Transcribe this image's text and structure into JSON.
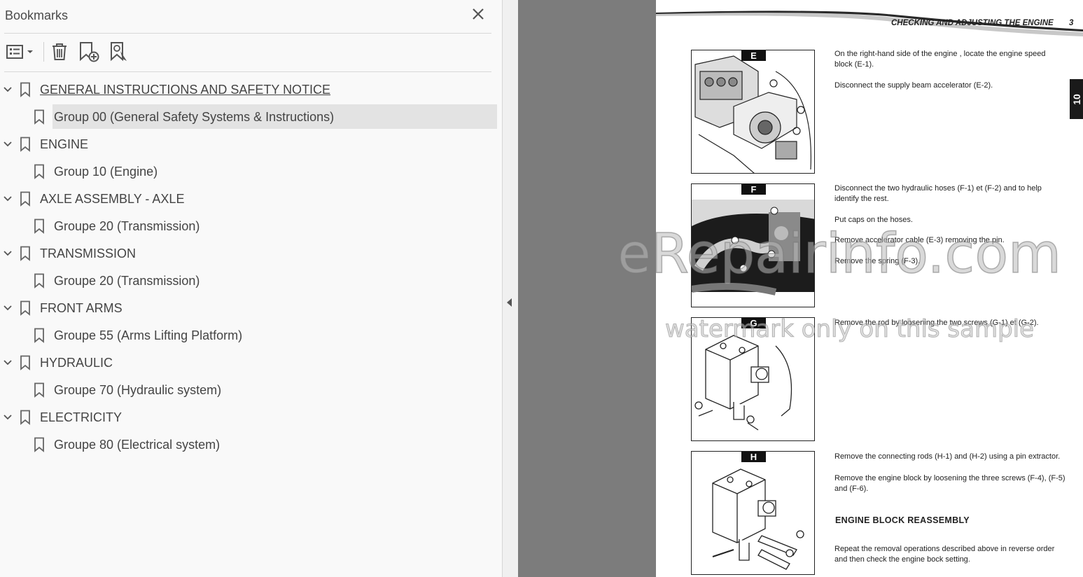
{
  "bookmarks_panel": {
    "title": "Bookmarks",
    "toolbar": {
      "options_icon": "list-options-icon",
      "delete_icon": "trash-icon",
      "add_icon": "add-bookmark-icon",
      "find_icon": "find-bookmark-icon"
    },
    "items": [
      {
        "label": "GENERAL INSTRUCTIONS AND SAFETY NOTICE",
        "level": 0,
        "expanded": true
      },
      {
        "label": "Group 00 (General Safety Systems & Instructions)",
        "level": 1,
        "selected": true
      },
      {
        "label": "ENGINE",
        "level": 0,
        "expanded": true
      },
      {
        "label": "Group 10 (Engine)",
        "level": 1
      },
      {
        "label": "AXLE ASSEMBLY - AXLE",
        "level": 0,
        "expanded": true
      },
      {
        "label": "Groupe 20 (Transmission)",
        "level": 1
      },
      {
        "label": "TRANSMISSION",
        "level": 0,
        "expanded": true
      },
      {
        "label": "Groupe 20 (Transmission)",
        "level": 1
      },
      {
        "label": "FRONT ARMS",
        "level": 0,
        "expanded": true
      },
      {
        "label": "Groupe 55 (Arms Lifting Platform)",
        "level": 1
      },
      {
        "label": "HYDRAULIC",
        "level": 0,
        "expanded": true
      },
      {
        "label": "Groupe 70 (Hydraulic system)",
        "level": 1
      },
      {
        "label": "ELECTRICITY",
        "level": 0,
        "expanded": true
      },
      {
        "label": "Groupe 80 (Electrical system)",
        "level": 1
      }
    ]
  },
  "document": {
    "header_title": "CHECKING AND ADJUSTING THE ENGINE",
    "page_number": "3",
    "section_tab": "10",
    "figures": [
      {
        "label": "E"
      },
      {
        "label": "F"
      },
      {
        "label": "G"
      },
      {
        "label": "H"
      }
    ],
    "paragraphs": {
      "e1": "On the right-hand side of the engine , locate the engine speed block (E-1).",
      "e2": "Disconnect the supply beam accelerator (E-2).",
      "f1": "Disconnect the two hydraulic hoses (F-1) et (F-2) and to help identify the rest.",
      "f2": "Put caps on the hoses.",
      "f3": "Remove accelerator cable (E-3) removing the pin.",
      "f4": "Remove the spring (F-3).",
      "g1": "Remove the rod by loosening the two screws (G-1) et (G-2).",
      "h1": "Remove the connecting rods (H-1) and (H-2) using a pin extractor.",
      "h2": "Remove the engine block by loosening the three screws (F-4), (F-5) and (F-6).",
      "heading": "ENGINE BLOCK REASSEMBLY",
      "h3": "Repeat the removal operations described above in reverse order and then check the  engine bock setting."
    }
  },
  "watermark": {
    "main": "eRepairinfo.com",
    "sub": "watermark only on this sample"
  },
  "colors": {
    "selection": "#e3e3e3",
    "viewport_bg": "#7c7c7c",
    "panel_bg": "#f9f9f9"
  }
}
